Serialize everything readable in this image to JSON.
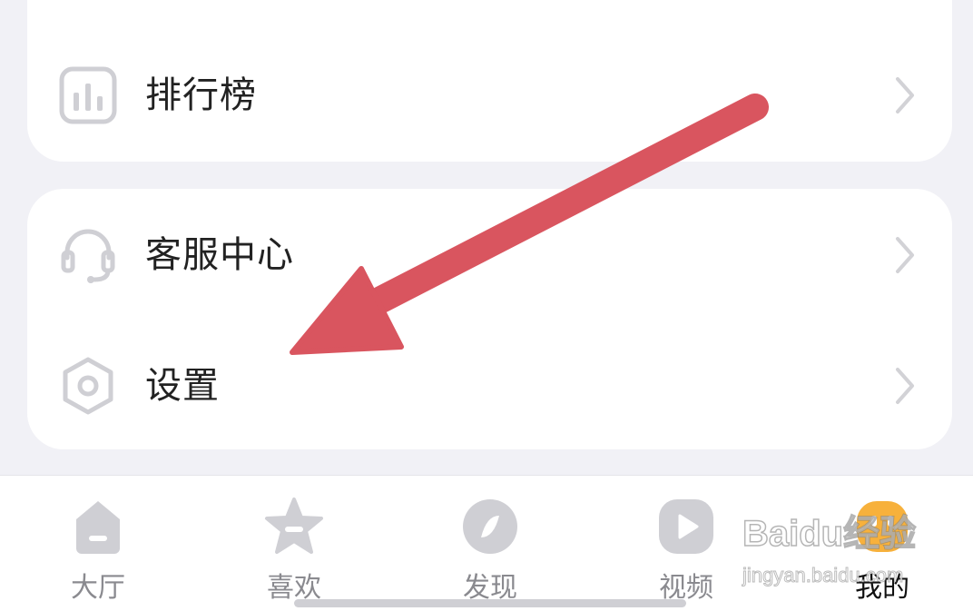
{
  "menu": {
    "ranking": {
      "label": "排行榜",
      "icon": "bar-chart-icon"
    },
    "service": {
      "label": "客服中心",
      "icon": "headset-icon"
    },
    "settings": {
      "label": "设置",
      "icon": "gear-hexagon-icon"
    }
  },
  "tabs": [
    {
      "label": "大厅",
      "icon": "home-icon",
      "active": false
    },
    {
      "label": "喜欢",
      "icon": "star-icon",
      "active": false
    },
    {
      "label": "发现",
      "icon": "compass-icon",
      "active": false
    },
    {
      "label": "视频",
      "icon": "play-icon",
      "active": false
    },
    {
      "label": "我的",
      "icon": "profile-face-icon",
      "active": true
    }
  ],
  "watermark": {
    "brand": "Baidu经验",
    "url": "jingyan.baidu.com"
  },
  "colors": {
    "background": "#f1f1f6",
    "card": "#ffffff",
    "icon_gray": "#cfcfd4",
    "arrow_red": "#d9555f",
    "active_tab_icon": "#f7b13c"
  }
}
